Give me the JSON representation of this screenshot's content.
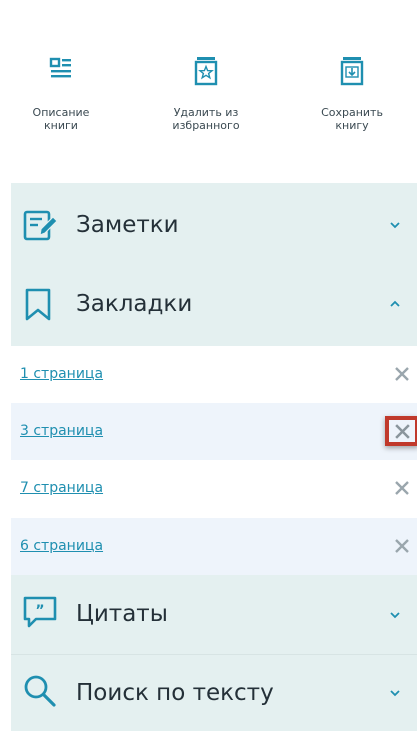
{
  "toolbar": {
    "items": [
      {
        "label": "Описание\nкниги",
        "icon": "book-description-icon"
      },
      {
        "label": "Удалить из\nизбранного",
        "icon": "remove-favorite-icon"
      },
      {
        "label": "Сохранить\nкнигу",
        "icon": "save-book-icon"
      }
    ]
  },
  "sections": {
    "notes": {
      "title": "Заметки",
      "state": "collapsed"
    },
    "bookmarks": {
      "title": "Закладки",
      "state": "expanded"
    },
    "quotes": {
      "title": "Цитаты",
      "state": "collapsed"
    },
    "search": {
      "title": "Поиск по тексту",
      "state": "collapsed"
    }
  },
  "bookmarks": [
    {
      "label": "1 страница"
    },
    {
      "label": "3 страница",
      "highlighted": true
    },
    {
      "label": "7 страница"
    },
    {
      "label": "6 страница"
    }
  ],
  "colors": {
    "accent": "#1f8fb0",
    "section_bg": "#e4f0f0",
    "row_alt_bg": "#eef4fb",
    "highlight": "#c0392b"
  }
}
